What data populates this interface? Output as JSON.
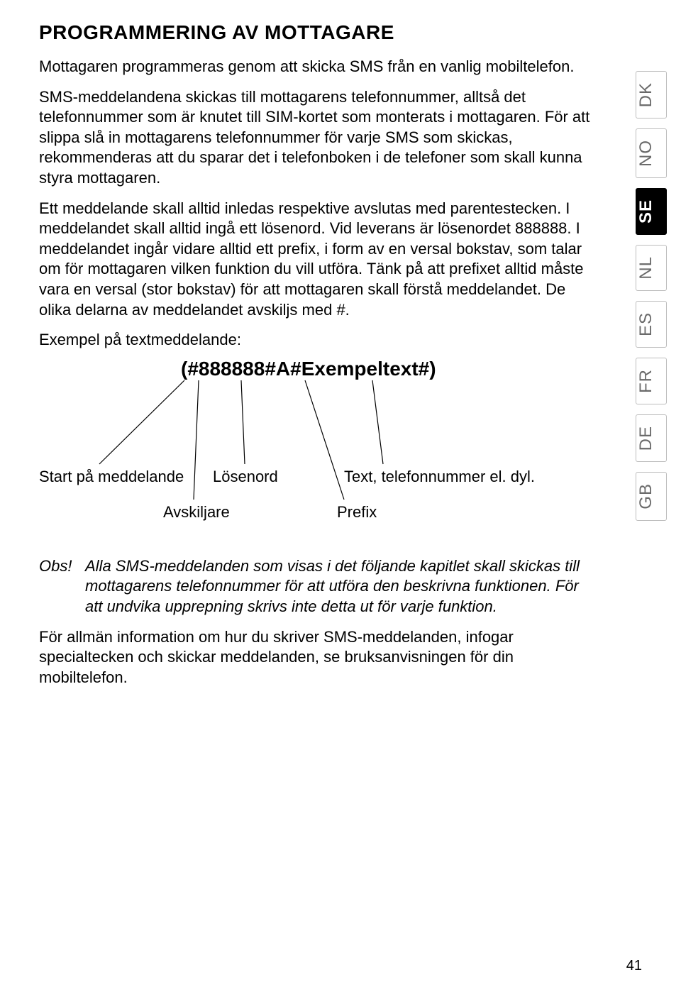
{
  "heading": "PROGRAMMERING AV MOTTAGARE",
  "para1": "Mottagaren programmeras genom att skicka SMS från en vanlig mobiltelefon.",
  "para2": "SMS-meddelandena skickas till mottagarens telefonnummer, alltså det telefonnummer som är knutet till SIM-kortet som monterats i mottagaren. För att slippa slå in mottagarens telefonnummer för varje SMS som skickas, rekommenderas att du sparar det i telefonboken i de telefoner som skall kunna styra mottagaren.",
  "para3": "Ett meddelande skall alltid inledas respektive avslutas med parentestecken. I meddelandet skall alltid ingå ett lösenord. Vid leverans är lösenordet 888888. I meddelandet ingår vidare alltid ett prefix, i form av en versal bokstav, som talar om för mottagaren vilken funktion du vill utföra. Tänk på att prefixet alltid måste vara en versal (stor bokstav) för att mottagaren skall förstå meddelandet. De olika delarna av meddelandet avskiljs med #.",
  "example_label": "Exempel på textmeddelande:",
  "example_text": "(#888888#A#Exempeltext#)",
  "legend": {
    "start": "Start på meddelande",
    "losenord": "Lösenord",
    "text": "Text, telefonnummer el. dyl.",
    "avskiljare": "Avskiljare",
    "prefix": "Prefix"
  },
  "note_prefix": "Obs!",
  "note_body": "Alla SMS-meddelanden som visas i det följande kapitlet skall skickas till mottagarens telefonnummer för att utföra den beskrivna funktionen. För att undvika upprepning skrivs inte detta ut för varje funktion.",
  "para4": "För allmän information om hur du skriver SMS-meddelanden, infogar specialtecken och skickar meddelanden, se bruksanvisningen för din mobiltelefon.",
  "tabs": [
    "DK",
    "NO",
    "SE",
    "NL",
    "ES",
    "FR",
    "DE",
    "GB"
  ],
  "active_tab": "SE",
  "page_number": "41"
}
